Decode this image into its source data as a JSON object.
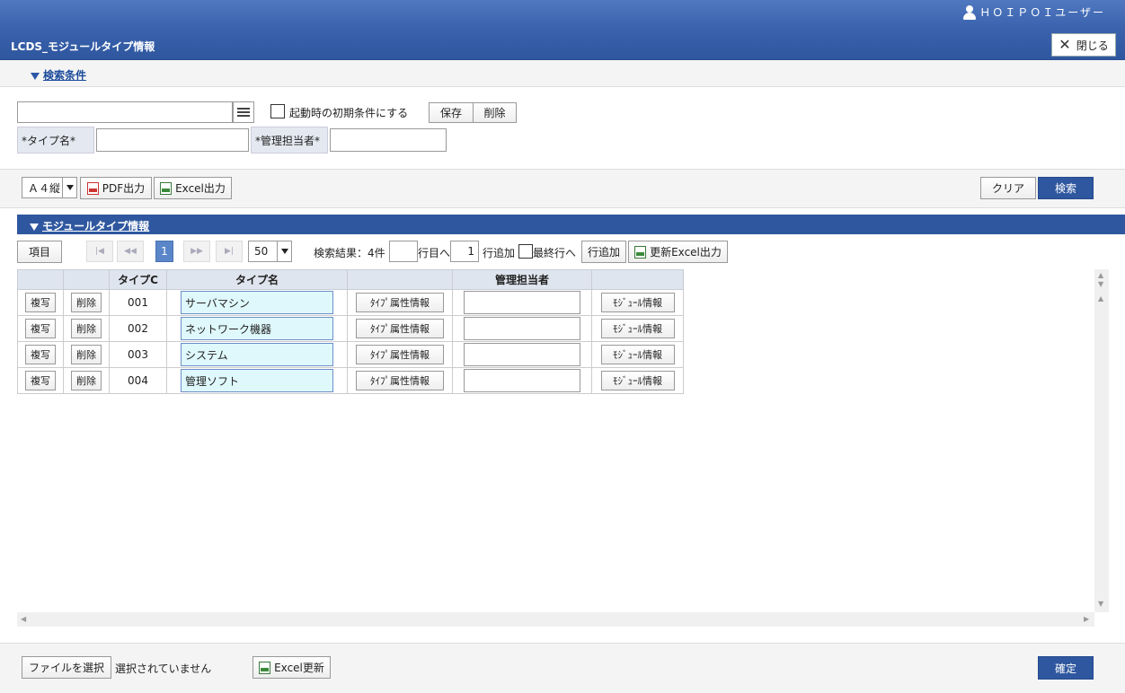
{
  "header": {
    "user": "ＨＯＩＰＯＩユーザー",
    "title": "LCDS_モジュールタイプ情報",
    "close_label": "閉じる"
  },
  "search": {
    "section_label": "検索条件",
    "startup_label": "起動時の初期条件にする",
    "save_label": "保存",
    "delete_label": "削除",
    "type_name_label": "*タイプ名*",
    "manager_label": "*管理担当者*"
  },
  "toolbar": {
    "paper_size": "Ａ４縦",
    "pdf_label": "PDF出力",
    "excel_label": "Excel出力",
    "clear_label": "クリア",
    "search_label": "検索"
  },
  "list": {
    "section_label": "モジュールタイプ情報",
    "items_label": "項目",
    "current_page": "1",
    "page_size": "50",
    "result_text": "検索結果：4件",
    "goto_row_suffix": "行目へ",
    "add_count": "1",
    "add_rows_label": "行追加",
    "last_row_label": "最終行へ",
    "add_row_button": "行追加",
    "update_excel_label": "更新Excel出力",
    "columns": [
      "",
      "",
      "タイプC",
      "タイプ名",
      "",
      "管理担当者",
      ""
    ],
    "copy_label": "複写",
    "delete_label": "削除",
    "attr_label": "ﾀｲﾌﾟ属性情報",
    "module_label": "ﾓｼﾞｭｰﾙ情報",
    "rows": [
      {
        "code": "001",
        "name": "サーバマシン"
      },
      {
        "code": "002",
        "name": "ネットワーク機器"
      },
      {
        "code": "003",
        "name": "システム"
      },
      {
        "code": "004",
        "name": "管理ソフト"
      }
    ]
  },
  "footer": {
    "file_label": "ファイルを選択",
    "file_status": "選択されていません",
    "excel_update_label": "Excel更新",
    "confirm_label": "確定"
  }
}
